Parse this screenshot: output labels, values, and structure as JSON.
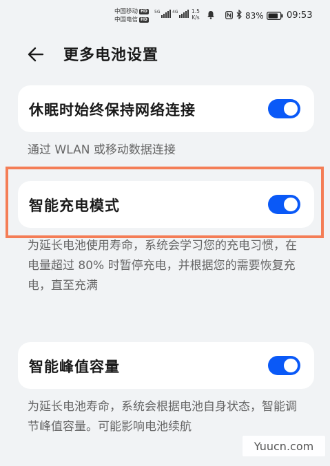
{
  "status_bar": {
    "carrier_1": "中国移动",
    "carrier_2": "中国电信",
    "hd_label": "HD",
    "net_1": "5G",
    "net_2": "4G",
    "speed_value": "1.5",
    "speed_unit": "K/s",
    "battery_percent": "83%",
    "time": "09:53"
  },
  "header": {
    "title": "更多电池设置"
  },
  "settings": [
    {
      "label": "休眠时始终保持网络连接",
      "enabled": true,
      "description": "通过 WLAN 或移动数据连接"
    },
    {
      "label": "智能充电模式",
      "enabled": true,
      "description": "为延长电池使用寿命，系统会学习您的充电习惯，在电量超过 80% 时暂停充电，并根据您的需要恢复充电，直至充满"
    },
    {
      "label": "智能峰值容量",
      "enabled": true,
      "description": "为延长电池寿命，系统会根据电池自身状态，智能调节峰值容量。可能影响电池续航"
    }
  ],
  "watermark": "Yuucn.com",
  "colors": {
    "accent": "#0a59f7",
    "highlight": "#f47d56",
    "background": "#f1f3f5"
  }
}
